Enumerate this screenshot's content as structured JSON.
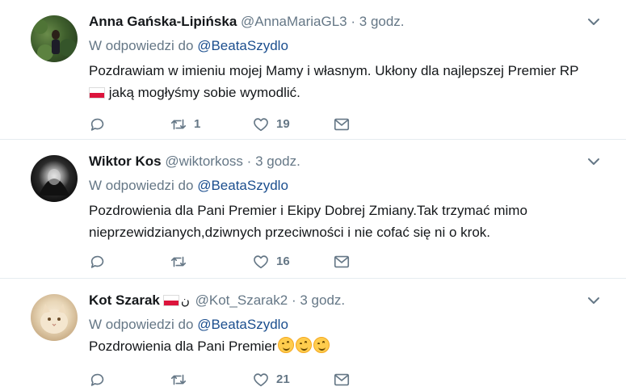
{
  "accent_color": "#1b4e8e",
  "muted_color": "#657786",
  "icons": {
    "reply": "reply-icon",
    "retweet": "retweet-icon",
    "like": "heart-icon",
    "message": "envelope-icon",
    "menu": "chevron-down-icon",
    "flag": "poland-flag-icon",
    "emoji": "smiling-face-icon"
  },
  "tweets": [
    {
      "name": "Anna Gańska-Lipińska",
      "handle": "@AnnaMariaGL3",
      "dot": "·",
      "time": "3 godz.",
      "reply_prefix": "W odpowiedzi do",
      "reply_mention": "@BeataSzydlo",
      "text_line1": "Pozdrawiam w imieniu mojej Mamy i własnym. Ukłony dla najlepszej Premier RP",
      "text_line2": " jaką mogłyśmy sobie wymodlić.",
      "replies": "",
      "retweets": "1",
      "likes": "19"
    },
    {
      "name": "Wiktor Kos",
      "handle": "@wiktorkoss",
      "dot": "·",
      "time": "3 godz.",
      "reply_prefix": "W odpowiedzi do",
      "reply_mention": "@BeataSzydlo",
      "text_line1": "Pozdrowienia dla Pani Premier i Ekipy Dobrej Zmiany.Tak trzymać mimo",
      "text_line2": "nieprzewidzianych,dziwnych przeciwności i nie cofać się ni o krok.",
      "replies": "",
      "retweets": "",
      "likes": "16"
    },
    {
      "name": "Kot Szarak",
      "name_glyph": "ن",
      "handle": "@Kot_Szarak2",
      "dot": "·",
      "time": "3 godz.",
      "reply_prefix": "W odpowiedzi do",
      "reply_mention": "@BeataSzydlo",
      "text_line1": "Pozdrowienia dla Pani Premier",
      "replies": "",
      "retweets": "",
      "likes": "21"
    }
  ]
}
